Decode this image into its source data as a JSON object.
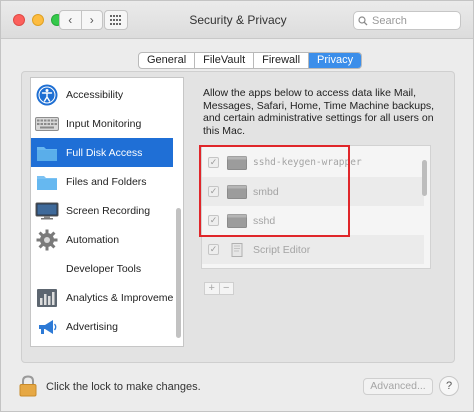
{
  "window": {
    "title": "Security & Privacy",
    "search_placeholder": "Search",
    "nav_back": "‹",
    "nav_forward": "›"
  },
  "tabs": [
    {
      "label": "General",
      "active": false
    },
    {
      "label": "FileVault",
      "active": false
    },
    {
      "label": "Firewall",
      "active": false
    },
    {
      "label": "Privacy",
      "active": true
    }
  ],
  "sidebar": {
    "items": [
      {
        "label": "Accessibility",
        "icon": "accessibility-icon",
        "selected": false
      },
      {
        "label": "Input Monitoring",
        "icon": "keyboard-icon",
        "selected": false
      },
      {
        "label": "Full Disk Access",
        "icon": "folder-icon",
        "selected": true
      },
      {
        "label": "Files and Folders",
        "icon": "folder-icon",
        "selected": false
      },
      {
        "label": "Screen Recording",
        "icon": "display-icon",
        "selected": false
      },
      {
        "label": "Automation",
        "icon": "gear-icon",
        "selected": false
      },
      {
        "label": "Developer Tools",
        "icon": "",
        "selected": false
      },
      {
        "label": "Analytics & Improveme…",
        "icon": "chart-icon",
        "selected": false
      },
      {
        "label": "Advertising",
        "icon": "megaphone-icon",
        "selected": false
      }
    ]
  },
  "description": "Allow the apps below to access data like Mail, Messages, Safari, Home, Time Machine backups, and certain administrative settings for all users on this Mac.",
  "apps": [
    {
      "name": "sshd-keygen-wrapper",
      "checked": true,
      "mono": true
    },
    {
      "name": "smbd",
      "checked": true,
      "mono": false
    },
    {
      "name": "sshd",
      "checked": true,
      "mono": false
    },
    {
      "name": "Script Editor",
      "checked": true,
      "mono": false
    }
  ],
  "list_controls": {
    "add": "+",
    "remove": "−"
  },
  "footer": {
    "lock_text": "Click the lock to make changes.",
    "advanced_label": "Advanced...",
    "help_label": "?"
  },
  "colors": {
    "accent": "#3b8eea",
    "selection": "#1f6fd6",
    "highlight_box": "#e0262a"
  }
}
